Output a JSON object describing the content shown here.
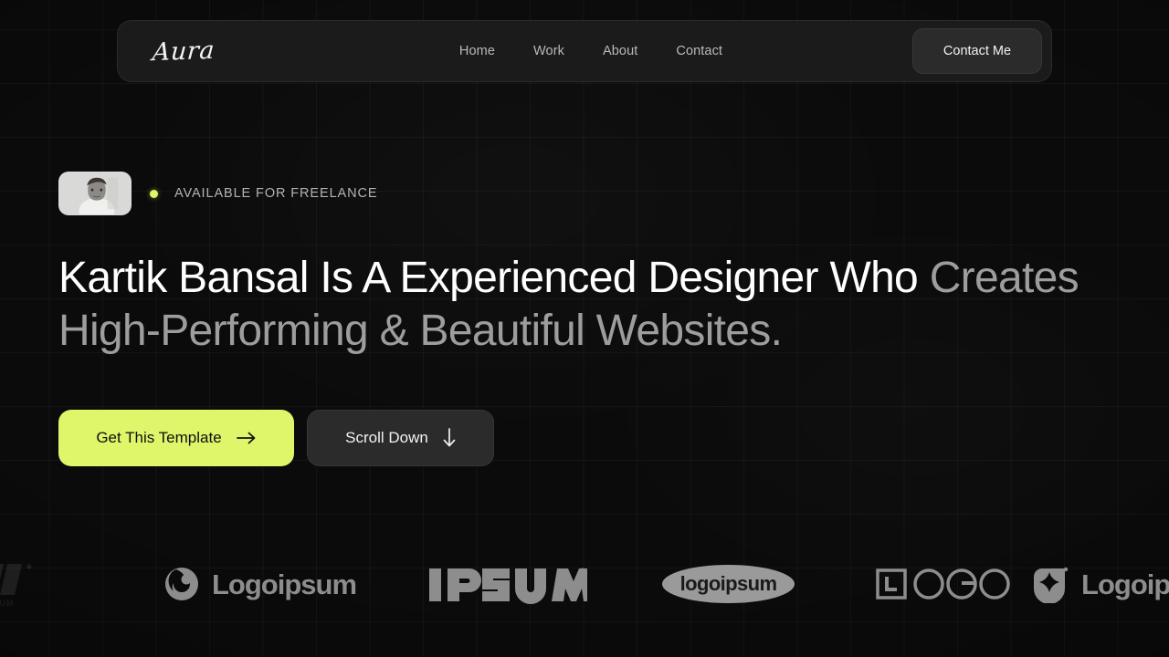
{
  "theme": {
    "background": "#0b0b0b",
    "surface": "#1b1b1b",
    "accent": "#dff56a",
    "text_primary": "#ffffff",
    "text_muted": "#9d9d9d"
  },
  "header": {
    "logo_text": "Aura",
    "nav": [
      {
        "label": "Home"
      },
      {
        "label": "Work"
      },
      {
        "label": "About"
      },
      {
        "label": "Contact"
      }
    ],
    "cta_label": "Contact Me"
  },
  "hero": {
    "availability_badge": "AVAILABLE FOR FREELANCE",
    "availability_dot_color": "#dff56a",
    "avatar_alt": "portrait-photo",
    "headline_lead": "Kartik Bansal Is A Experienced Designer Who ",
    "headline_tail": "Creates High-Performing & Beautiful Websites.",
    "primary_button": "Get This Template",
    "primary_button_icon": "arrow-right-icon",
    "secondary_button": "Scroll Down",
    "secondary_button_icon": "arrow-down-icon"
  },
  "logo_strip": {
    "items": [
      {
        "name": "ipsum-slashes-logo",
        "word": "IPSUM",
        "style": "clipped"
      },
      {
        "name": "logoipsum-swirl-logo",
        "word": "Logoipsum",
        "style": "icon-word"
      },
      {
        "name": "ipsum-bold-logo",
        "word": "IPSUM",
        "style": "word-dot"
      },
      {
        "name": "logoipsum-ellipse-logo",
        "word": "logoipsum",
        "style": "pill"
      },
      {
        "name": "logo-outline-logo",
        "word": "LOGO",
        "style": "outline"
      },
      {
        "name": "logoipsum-shield-logo",
        "word": "Logoipsum",
        "style": "icon-word"
      }
    ]
  }
}
